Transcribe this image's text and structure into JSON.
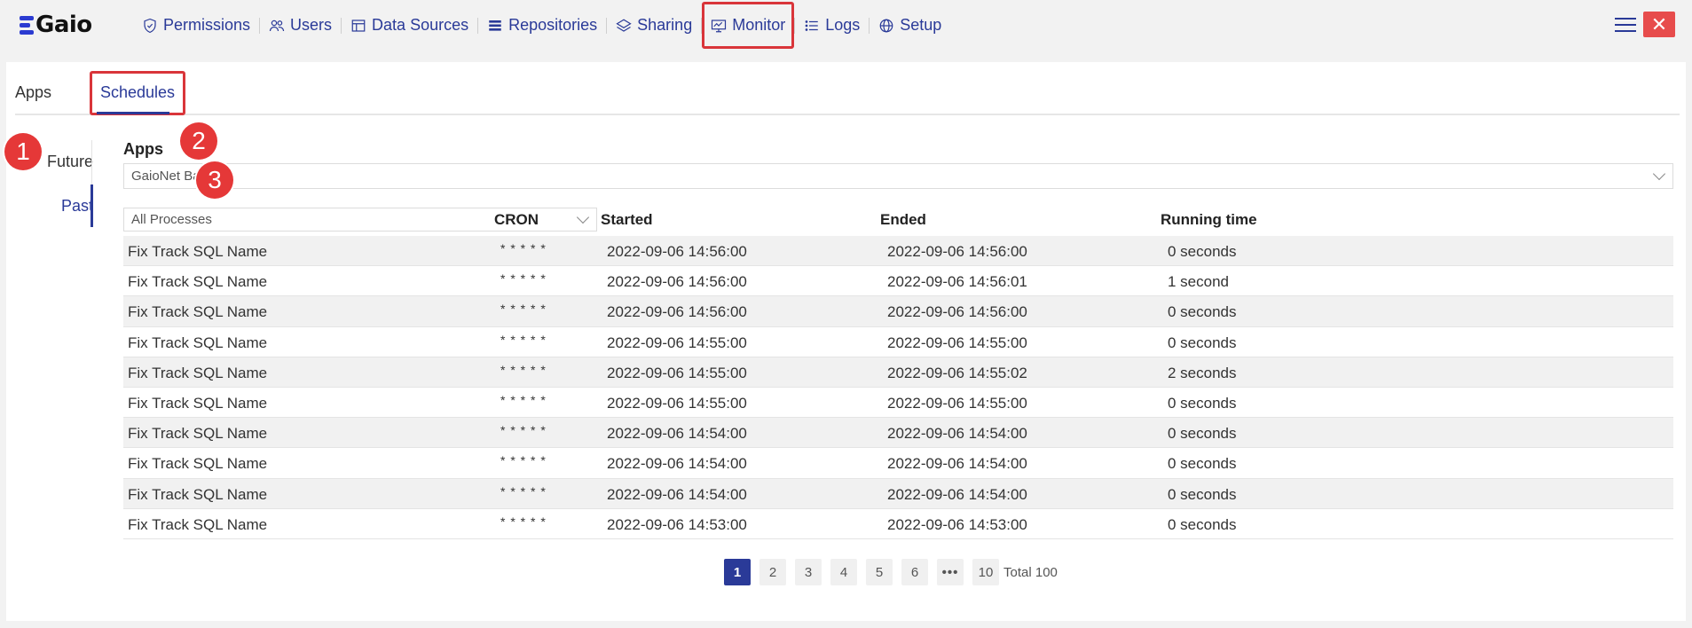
{
  "brand": {
    "name": "Gaio",
    "color": "#2b3bd1"
  },
  "nav": [
    {
      "label": "Permissions",
      "icon": "shield-icon"
    },
    {
      "label": "Users",
      "icon": "users-icon"
    },
    {
      "label": "Data Sources",
      "icon": "table-icon"
    },
    {
      "label": "Repositories",
      "icon": "list-icon"
    },
    {
      "label": "Sharing",
      "icon": "layers-icon"
    },
    {
      "label": "Monitor",
      "icon": "monitor-icon"
    },
    {
      "label": "Logs",
      "icon": "bullet-list-icon"
    },
    {
      "label": "Setup",
      "icon": "globe-icon"
    }
  ],
  "window": {
    "menu_icon": "hamburger-icon",
    "close_label": "✕"
  },
  "tabs": {
    "apps": "Apps",
    "schedules": "Schedules"
  },
  "side": {
    "future": "Future",
    "past": "Past"
  },
  "apps_section": {
    "label": "Apps",
    "selected": "GaioNet Base"
  },
  "process_filter": {
    "selected": "All Processes"
  },
  "badges": [
    "1",
    "2",
    "3"
  ],
  "table": {
    "headers": {
      "cron": "CRON",
      "started": "Started",
      "ended": "Ended",
      "running": "Running time"
    },
    "rows": [
      {
        "name": "Fix Track SQL Name",
        "cron": "* * * * *",
        "started": "2022-09-06 14:56:00",
        "ended": "2022-09-06 14:56:00",
        "running": "0 seconds"
      },
      {
        "name": "Fix Track SQL Name",
        "cron": "* * * * *",
        "started": "2022-09-06 14:56:00",
        "ended": "2022-09-06 14:56:01",
        "running": "1 second"
      },
      {
        "name": "Fix Track SQL Name",
        "cron": "* * * * *",
        "started": "2022-09-06 14:56:00",
        "ended": "2022-09-06 14:56:00",
        "running": "0 seconds"
      },
      {
        "name": "Fix Track SQL Name",
        "cron": "* * * * *",
        "started": "2022-09-06 14:55:00",
        "ended": "2022-09-06 14:55:00",
        "running": "0 seconds"
      },
      {
        "name": "Fix Track SQL Name",
        "cron": "* * * * *",
        "started": "2022-09-06 14:55:00",
        "ended": "2022-09-06 14:55:02",
        "running": "2 seconds"
      },
      {
        "name": "Fix Track SQL Name",
        "cron": "* * * * *",
        "started": "2022-09-06 14:55:00",
        "ended": "2022-09-06 14:55:00",
        "running": "0 seconds"
      },
      {
        "name": "Fix Track SQL Name",
        "cron": "* * * * *",
        "started": "2022-09-06 14:54:00",
        "ended": "2022-09-06 14:54:00",
        "running": "0 seconds"
      },
      {
        "name": "Fix Track SQL Name",
        "cron": "* * * * *",
        "started": "2022-09-06 14:54:00",
        "ended": "2022-09-06 14:54:00",
        "running": "0 seconds"
      },
      {
        "name": "Fix Track SQL Name",
        "cron": "* * * * *",
        "started": "2022-09-06 14:54:00",
        "ended": "2022-09-06 14:54:00",
        "running": "0 seconds"
      },
      {
        "name": "Fix Track SQL Name",
        "cron": "* * * * *",
        "started": "2022-09-06 14:53:00",
        "ended": "2022-09-06 14:53:00",
        "running": "0 seconds"
      }
    ]
  },
  "pagination": {
    "pages": [
      "1",
      "2",
      "3",
      "4",
      "5",
      "6",
      "•••",
      "10"
    ],
    "active": "1",
    "total": "Total 100"
  },
  "colors": {
    "accent": "#2a3a98",
    "highlight": "#d9353a",
    "badge": "#e53838"
  }
}
